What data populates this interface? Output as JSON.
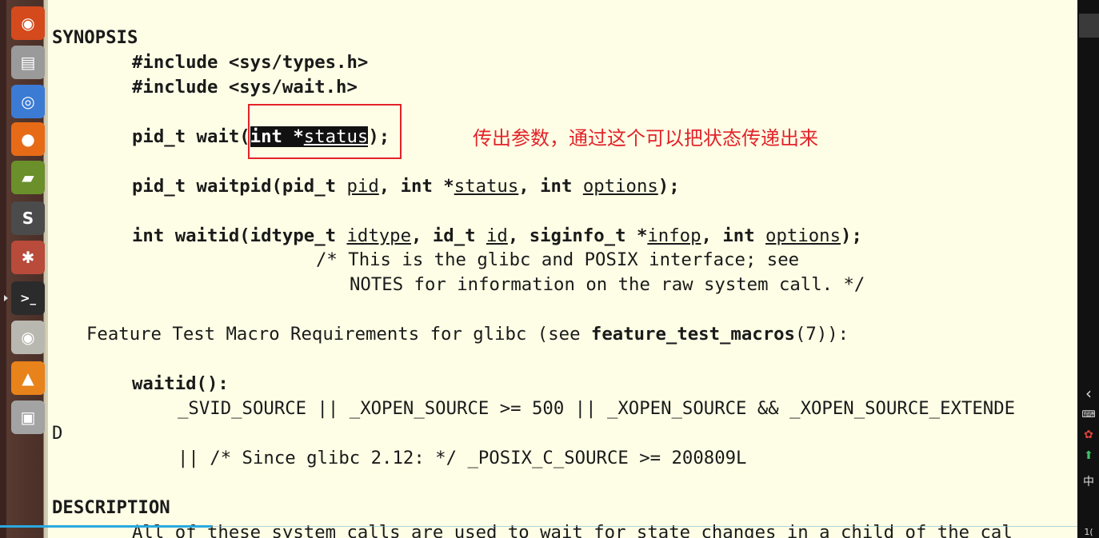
{
  "launcher": {
    "items": [
      {
        "name": "ubuntu-dash-icon",
        "glyph": "◉",
        "color": "#d44a1c"
      },
      {
        "name": "files-icon",
        "glyph": "▤",
        "color": "#9a9a9a"
      },
      {
        "name": "chromium-icon",
        "glyph": "◎",
        "color": "#3b7bd4"
      },
      {
        "name": "firefox-icon",
        "glyph": "●",
        "color": "#e76b16"
      },
      {
        "name": "books-icon",
        "glyph": "▰",
        "color": "#6a8f2b"
      },
      {
        "name": "sublime-icon",
        "glyph": "S",
        "color": "#4b4b4b"
      },
      {
        "name": "settings-icon",
        "glyph": "✱",
        "color": "#b84b3a"
      },
      {
        "name": "terminal-icon",
        "glyph": ">_",
        "color": "#2b2b2b"
      },
      {
        "name": "disk-icon",
        "glyph": "◉",
        "color": "#b8b8b0"
      },
      {
        "name": "vlc-icon",
        "glyph": "▲",
        "color": "#e8821a"
      },
      {
        "name": "save-icon",
        "glyph": "▣",
        "color": "#a3a3a3"
      }
    ]
  },
  "man": {
    "synopsis_heading": "SYNOPSIS",
    "include1": "#include <sys/types.h>",
    "include2": "#include <sys/wait.h>",
    "wait_decl": {
      "p1": "pid_t wait(",
      "int_star": "int *",
      "param": "status",
      "p2": ");"
    },
    "waitpid_decl": {
      "p1": "pid_t waitpid(pid_t ",
      "pid": "pid",
      "p2": ", int *",
      "status": "status",
      "p3": ", int ",
      "options": "options",
      "p4": ");"
    },
    "waitid_decl": {
      "p1": "int waitid(idtype_t ",
      "idtype": "idtype",
      "p2": ", id_t ",
      "id": "id",
      "p3": ", siginfo_t *",
      "infop": "infop",
      "p4": ", int ",
      "options": "options",
      "p5": ");"
    },
    "comment1": "/* This is the glibc and POSIX interface; see",
    "comment2": "NOTES for information on the raw system call. */",
    "feature": {
      "p1": "Feature Test Macro Requirements for glibc (see ",
      "macros": "feature_test_macros",
      "p2": "(7)):"
    },
    "waitid_label": "waitid():",
    "svid_line": "_SVID_SOURCE || _XOPEN_SOURCE >= 500 || _XOPEN_SOURCE && _XOPEN_SOURCE_EXTENDE",
    "wrap_d": "D",
    "since_line": "|| /* Since glibc 2.12: */ _POSIX_C_SOURCE >= 200809L",
    "description_heading": "DESCRIPTION",
    "desc_line": "All of these system calls are used to wait for state changes in a child of the cal"
  },
  "annotation": "传出参数，通过这个可以把状态传递出来",
  "tray": {
    "arrow": "‹",
    "ime": "中",
    "clock_fragment": "1("
  },
  "colors": {
    "background": "#fefee6",
    "annotation": "#e2232a",
    "progress": "#2aa8e0"
  }
}
